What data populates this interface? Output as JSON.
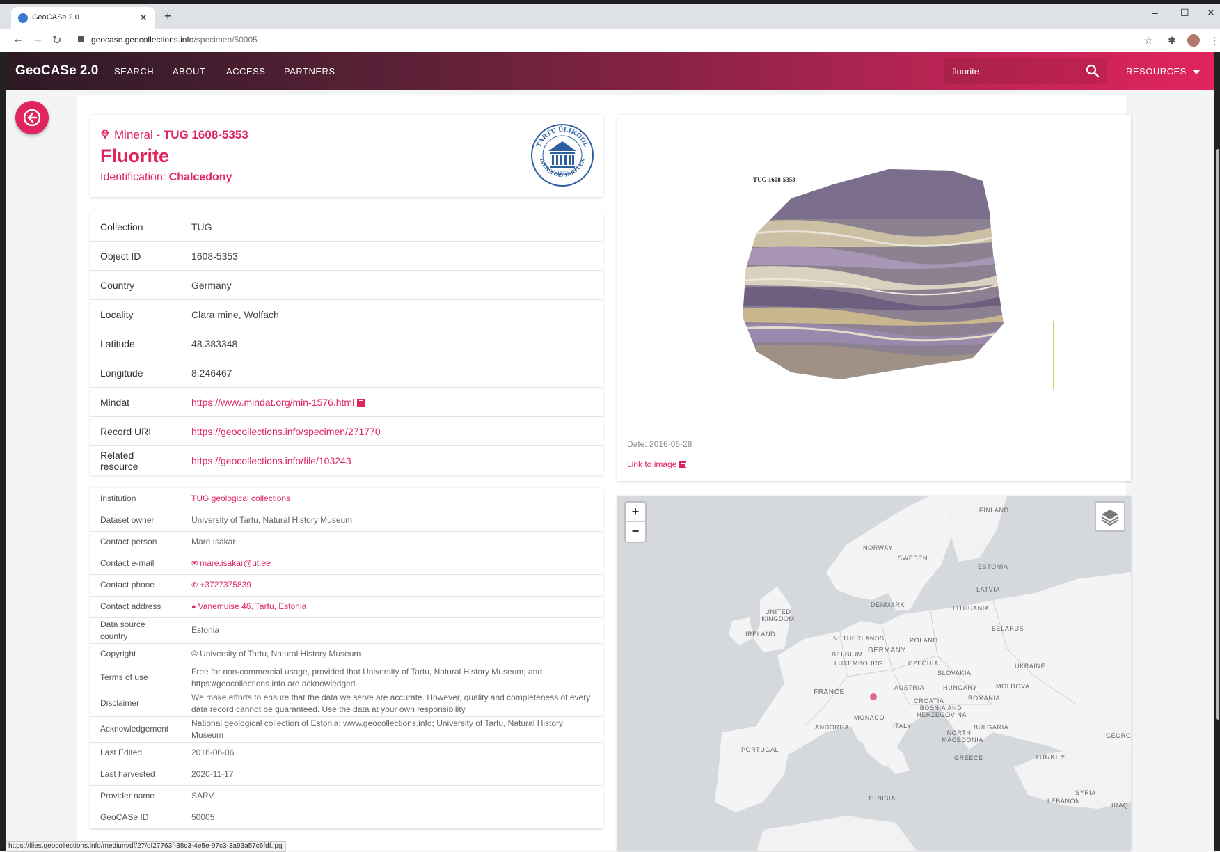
{
  "browser": {
    "tab_title": "GeoCASe 2.0",
    "tab_close": "✕",
    "new_tab": "+",
    "url_host": "geocase.geocollections.info",
    "url_path": "/specimen/50005",
    "status_url": "https://files.geocollections.info/medium/df/27/df27763f-38c3-4e5e-97c3-3a93a57c6fdf.jpg",
    "window_controls": {
      "minimize": "–",
      "maximize": "☐",
      "close": "✕"
    },
    "nav": {
      "back": "←",
      "forward": "→",
      "reload": "↻"
    },
    "icons": {
      "bookmark": "☆",
      "extensions": "puzzle-icon"
    }
  },
  "header": {
    "brand": "GeoCASe 2.0",
    "nav": [
      "SEARCH",
      "ABOUT",
      "ACCESS",
      "PARTNERS"
    ],
    "search_value": "fluorite",
    "resources_label": "RESOURCES"
  },
  "specimen": {
    "kind": "Mineral - ",
    "number": "TUG 1608-5353",
    "name": "Fluorite",
    "identification_label": "Identification: ",
    "identification_value": "Chalcedony",
    "logo_text": "TARTU ÜLIKOOL · UNIVERSITAS TARTUENSIS · 1632"
  },
  "details": [
    {
      "label": "Collection",
      "value": "TUG"
    },
    {
      "label": "Object ID",
      "value": "1608-5353"
    },
    {
      "label": "Country",
      "value": "Germany"
    },
    {
      "label": "Locality",
      "value": "Clara mine, Wolfach"
    },
    {
      "label": "Latitude",
      "value": "48.383348"
    },
    {
      "label": "Longitude",
      "value": "8.246467"
    },
    {
      "label": "Mindat",
      "value": "https://www.mindat.org/min-1576.html"
    },
    {
      "label": "Record URI",
      "value": "https://geocollections.info/specimen/271770"
    },
    {
      "label": "Related resource",
      "value": "https://geocollections.info/file/103243"
    }
  ],
  "meta": [
    {
      "label": "Institution",
      "value": "TUG geological collections"
    },
    {
      "label": "Dataset owner",
      "value": "University of Tartu, Natural History Museum"
    },
    {
      "label": "Contact person",
      "value": "Mare Isakar"
    },
    {
      "label": "Contact e-mail",
      "value": "mare.isakar@ut.ee"
    },
    {
      "label": "Contact phone",
      "value": "+3727375839"
    },
    {
      "label": "Contact address",
      "value": "Vanemuise 46, Tartu, Estonia"
    },
    {
      "label": "Data source country",
      "value": "Estonia"
    },
    {
      "label": "Copyright",
      "value": "© University of Tartu, Natural History Museum"
    },
    {
      "label": "Terms of use",
      "value": "Free for non-commercial usage, provided that University of Tartu, Natural History Museum, and https://geocollections.info are acknowledged."
    },
    {
      "label": "Disclaimer",
      "value": "We make efforts to ensure that the data we serve are accurate. However, quality and completeness of every data record cannot be guaranteed. Use the data at your own responsibility."
    },
    {
      "label": "Acknowledgement",
      "value": "National geological collection of Estonia: www.geocollections.info; University of Tartu, Natural History Museum"
    },
    {
      "label": "Last Edited",
      "value": "2016-06-06"
    },
    {
      "label": "Last harvested",
      "value": "2020-11-17"
    },
    {
      "label": "Provider name",
      "value": "SARV"
    },
    {
      "label": "GeoCASe ID",
      "value": "50005"
    }
  ],
  "image": {
    "label": "TUG 1608-5353",
    "date": "Date: 2016-06-28",
    "link": "Link to image"
  },
  "map": {
    "zoom_in": "+",
    "zoom_out": "−",
    "countries": [
      "FINLAND",
      "NORWAY",
      "SWEDEN",
      "ESTONIA",
      "LATVIA",
      "DENMARK",
      "LITHUANIA",
      "UNITED KINGDOM",
      "IRELAND",
      "NETHERLANDS",
      "POLAND",
      "BELARUS",
      "BELGIUM",
      "GERMANY",
      "LUXEMBOURG",
      "CZECHIA",
      "UKRAINE",
      "SLOVAKIA",
      "FRANCE",
      "AUSTRIA",
      "HUNGARY",
      "MOLDOVA",
      "ROMANIA",
      "CROATIA",
      "BOSNIA AND HERZEGOVINA",
      "MONACO",
      "ITALY",
      "ANDORRA",
      "BULGARIA",
      "NORTH MACEDONIA",
      "PORTUGAL",
      "GREECE",
      "TURKEY",
      "GEORG",
      "TUNISIA",
      "SYRIA",
      "LEBANON",
      "IRAQ"
    ]
  },
  "colors": {
    "accent": "#e0245d",
    "header_dark": "#2c1a24"
  }
}
